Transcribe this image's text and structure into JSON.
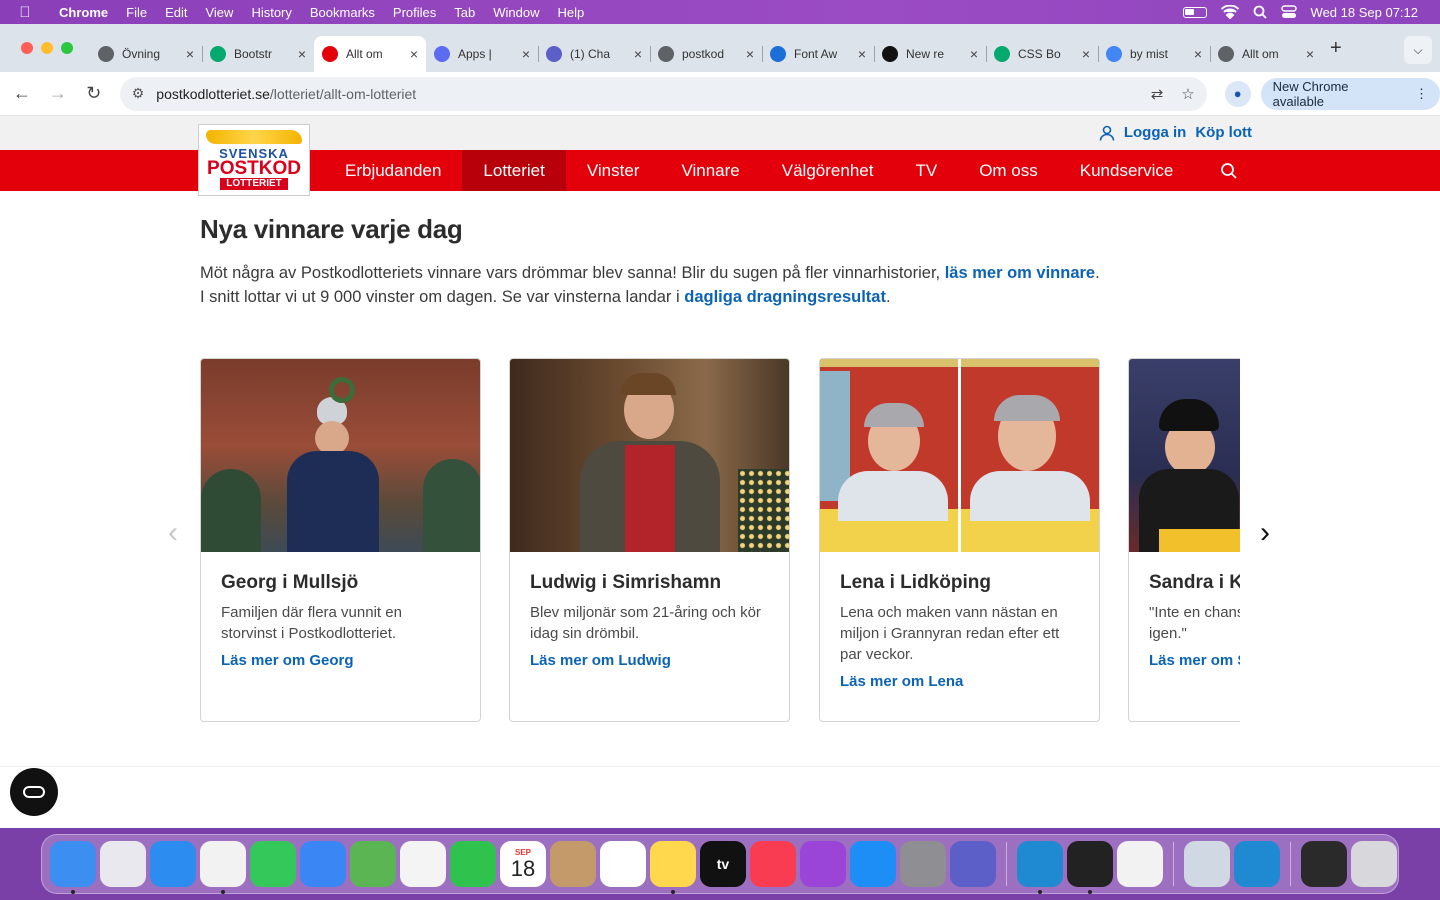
{
  "menubar": {
    "app": "Chrome",
    "items": [
      "File",
      "Edit",
      "View",
      "History",
      "Bookmarks",
      "Profiles",
      "Tab",
      "Window",
      "Help"
    ],
    "datetime": "Wed 18 Sep  07:12"
  },
  "tabs": [
    {
      "title": "Övning",
      "icon": "globe-icon",
      "color": "#5f6368"
    },
    {
      "title": "Bootstr",
      "icon": "w-icon",
      "color": "#04aa6d"
    },
    {
      "title": "Allt om",
      "icon": "postkod-icon",
      "color": "#e3000b",
      "active": true
    },
    {
      "title": "Apps |",
      "icon": "apps-icon",
      "color": "#5b6cf0"
    },
    {
      "title": "(1) Cha",
      "icon": "teams-icon",
      "color": "#5b5fc7"
    },
    {
      "title": "postkod",
      "icon": "globe-icon",
      "color": "#5f6368"
    },
    {
      "title": "Font Aw",
      "icon": "flag-icon",
      "color": "#1d6fd8"
    },
    {
      "title": "New re",
      "icon": "github-icon",
      "color": "#111111"
    },
    {
      "title": "CSS Bo",
      "icon": "w-icon",
      "color": "#04aa6d"
    },
    {
      "title": "by mist",
      "icon": "google-icon",
      "color": "#4285f4"
    },
    {
      "title": "Allt om",
      "icon": "globe-icon",
      "color": "#5f6368"
    }
  ],
  "toolbar": {
    "url_host": "postkodlotteriet.se",
    "url_path": "/lotteriet/allt-om-lotteriet",
    "new_chrome": "New Chrome available"
  },
  "site": {
    "login": "Logga in",
    "buy": "Köp lott",
    "logo": {
      "line1": "SVENSKA",
      "line2": "POSTKOD",
      "line3": "LOTTERIET"
    },
    "nav": [
      "Erbjudanden",
      "Lotteriet",
      "Vinster",
      "Vinnare",
      "Välgörenhet",
      "TV",
      "Om oss",
      "Kundservice"
    ],
    "active_nav": "Lotteriet"
  },
  "main": {
    "heading": "Nya vinnare varje dag",
    "intro1": "Möt några av Postkodlotteriets vinnare vars drömmar blev sanna! Blir du sugen på fler vinnarhistorier, ",
    "intro1_link": "läs mer om vinnare",
    "intro2": "I snitt lottar vi ut 9 000 vinster om dagen. Se var vinsterna landar i ",
    "intro2_link": "dagliga dragningsresultat",
    "period": "."
  },
  "cards": [
    {
      "name": "Georg i Mullsjö",
      "desc": "Familjen där flera vunnit en storvinst i Postkodlotteriet.",
      "link": "Läs mer om Georg"
    },
    {
      "name": "Ludwig i Simrishamn",
      "desc": "Blev miljonär som 21-åring och kör idag sin drömbil.",
      "link": "Läs mer om Ludwig"
    },
    {
      "name": "Lena i Lidköping",
      "desc": "Lena och maken vann nästan en miljon i Grannyran redan efter ett par veckor.",
      "link": "Läs mer om Lena"
    },
    {
      "name": "Sandra i Karlstad",
      "desc": "\"Inte en chans att jag skulle vinna igen.\"",
      "link": "Läs mer om Sandra"
    }
  ],
  "dock": [
    {
      "icon": "finder-icon",
      "color": "#3c8ef0"
    },
    {
      "icon": "launchpad-icon",
      "color": "#e8e8ee"
    },
    {
      "icon": "safari-icon",
      "color": "#2d8cf0"
    },
    {
      "icon": "chrome-icon",
      "color": "#f2f2f2"
    },
    {
      "icon": "messages-icon",
      "color": "#34c759"
    },
    {
      "icon": "mail-icon",
      "color": "#3a86f5"
    },
    {
      "icon": "maps-icon",
      "color": "#5ab552"
    },
    {
      "icon": "photos-icon",
      "color": "#f4f4f4"
    },
    {
      "icon": "facetime-icon",
      "color": "#2fc34e"
    },
    {
      "icon": "calendar-icon",
      "color": "#ffffff"
    },
    {
      "icon": "contacts-icon",
      "color": "#c59a6a"
    },
    {
      "icon": "reminders-icon",
      "color": "#ffffff"
    },
    {
      "icon": "notes-icon",
      "color": "#ffd84d"
    },
    {
      "icon": "appletv-icon",
      "color": "#111111"
    },
    {
      "icon": "music-icon",
      "color": "#fa3c52"
    },
    {
      "icon": "podcasts-icon",
      "color": "#9b44d8"
    },
    {
      "icon": "appstore-icon",
      "color": "#1c8ef5"
    },
    {
      "icon": "settings-icon",
      "color": "#8e8e93"
    },
    {
      "icon": "teams-icon",
      "color": "#5b5fc7"
    },
    {
      "icon": "vscode-icon",
      "color": "#1f8ad2"
    },
    {
      "icon": "terminal-icon",
      "color": "#222222"
    },
    {
      "icon": "textedit-icon",
      "color": "#f2f2f2"
    },
    {
      "icon": "preview-icon",
      "color": "#cfd8e3"
    },
    {
      "icon": "vscode-icon",
      "color": "#1f8ad2"
    },
    {
      "icon": "screen-icon",
      "color": "#2a2a2a"
    },
    {
      "icon": "trash-icon",
      "color": "#d8d8dc"
    }
  ],
  "dock_text": {
    "calendar_month": "SEP",
    "calendar_day": "18",
    "tv": "tv"
  }
}
